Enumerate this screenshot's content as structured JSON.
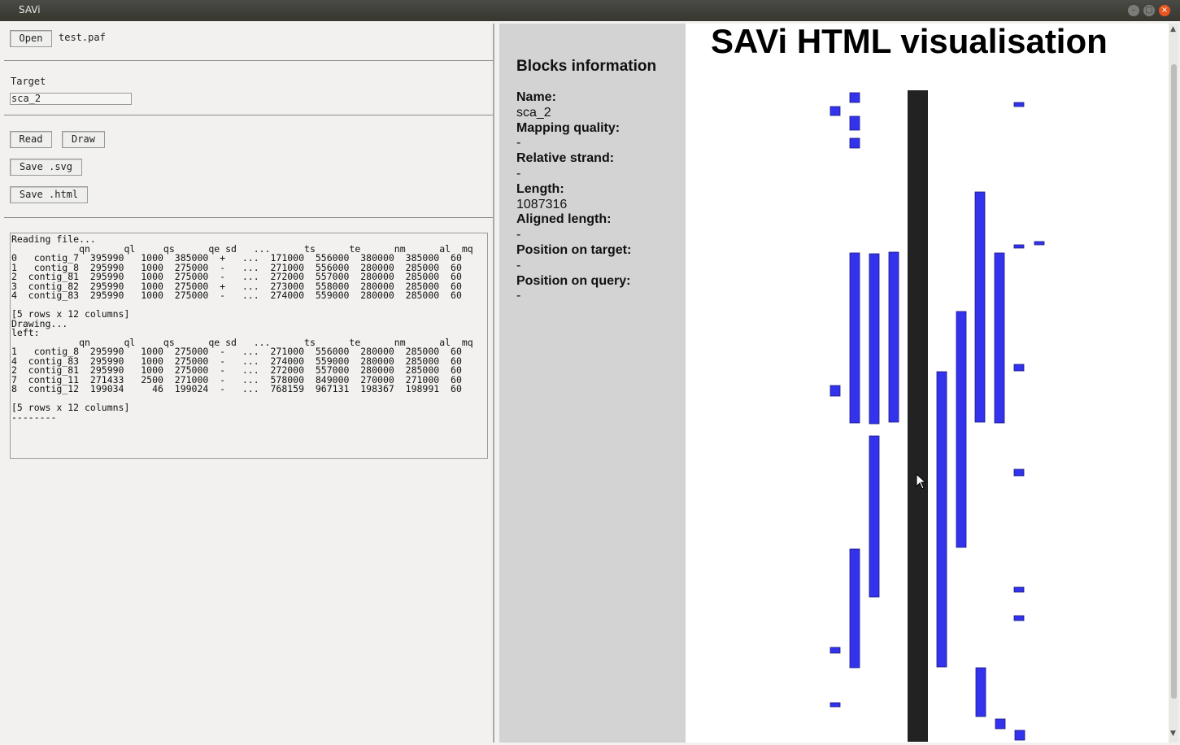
{
  "window": {
    "title": "SAVi"
  },
  "left": {
    "open_label": "Open",
    "filename": "test.paf",
    "target_label": "Target",
    "target_value": "sca_2",
    "read_label": "Read",
    "draw_label": "Draw",
    "save_svg_label": "Save .svg",
    "save_html_label": "Save .html",
    "console_lines": [
      "Reading file...",
      "            qn      ql     qs      qe sd   ...      ts      te      nm      al  mq",
      "0   contig_7  395990   1000  385000  +   ...  171000  556000  380000  385000  60",
      "1   contig_8  295990   1000  275000  -   ...  271000  556000  280000  285000  60",
      "2  contig_81  295990   1000  275000  -   ...  272000  557000  280000  285000  60",
      "3  contig_82  295990   1000  275000  +   ...  273000  558000  280000  285000  60",
      "4  contig_83  295990   1000  275000  -   ...  274000  559000  280000  285000  60",
      "",
      "[5 rows x 12 columns]",
      "Drawing...",
      "left:",
      "            qn      ql     qs      qe sd   ...      ts      te      nm      al  mq",
      "1   contig_8  295990   1000  275000  -   ...  271000  556000  280000  285000  60",
      "4  contig_83  295990   1000  275000  -   ...  274000  559000  280000  285000  60",
      "2  contig_81  295990   1000  275000  -   ...  272000  557000  280000  285000  60",
      "7  contig_11  271433   2500  271000  -   ...  578000  849000  270000  271000  60",
      "8  contig_12  199034     46  199024  -   ...  768159  967131  198367  198991  60",
      "",
      "[5 rows x 12 columns]",
      "--------"
    ]
  },
  "info": {
    "heading": "Blocks information",
    "name_label": "Name:",
    "name_value": "sca_2",
    "mq_label": "Mapping quality:",
    "mq_value": "-",
    "strand_label": "Relative strand:",
    "strand_value": "-",
    "length_label": "Length:",
    "length_value": "1087316",
    "aligned_label": "Aligned length:",
    "aligned_value": "-",
    "pos_target_label": "Position on target:",
    "pos_target_value": "-",
    "pos_query_label": "Position on query:",
    "pos_query_value": "-"
  },
  "visual": {
    "title": "SAVi HTML visualisation",
    "target_color": "#222222",
    "block_color": "#3333ee",
    "block_border": "#1a1a80"
  }
}
